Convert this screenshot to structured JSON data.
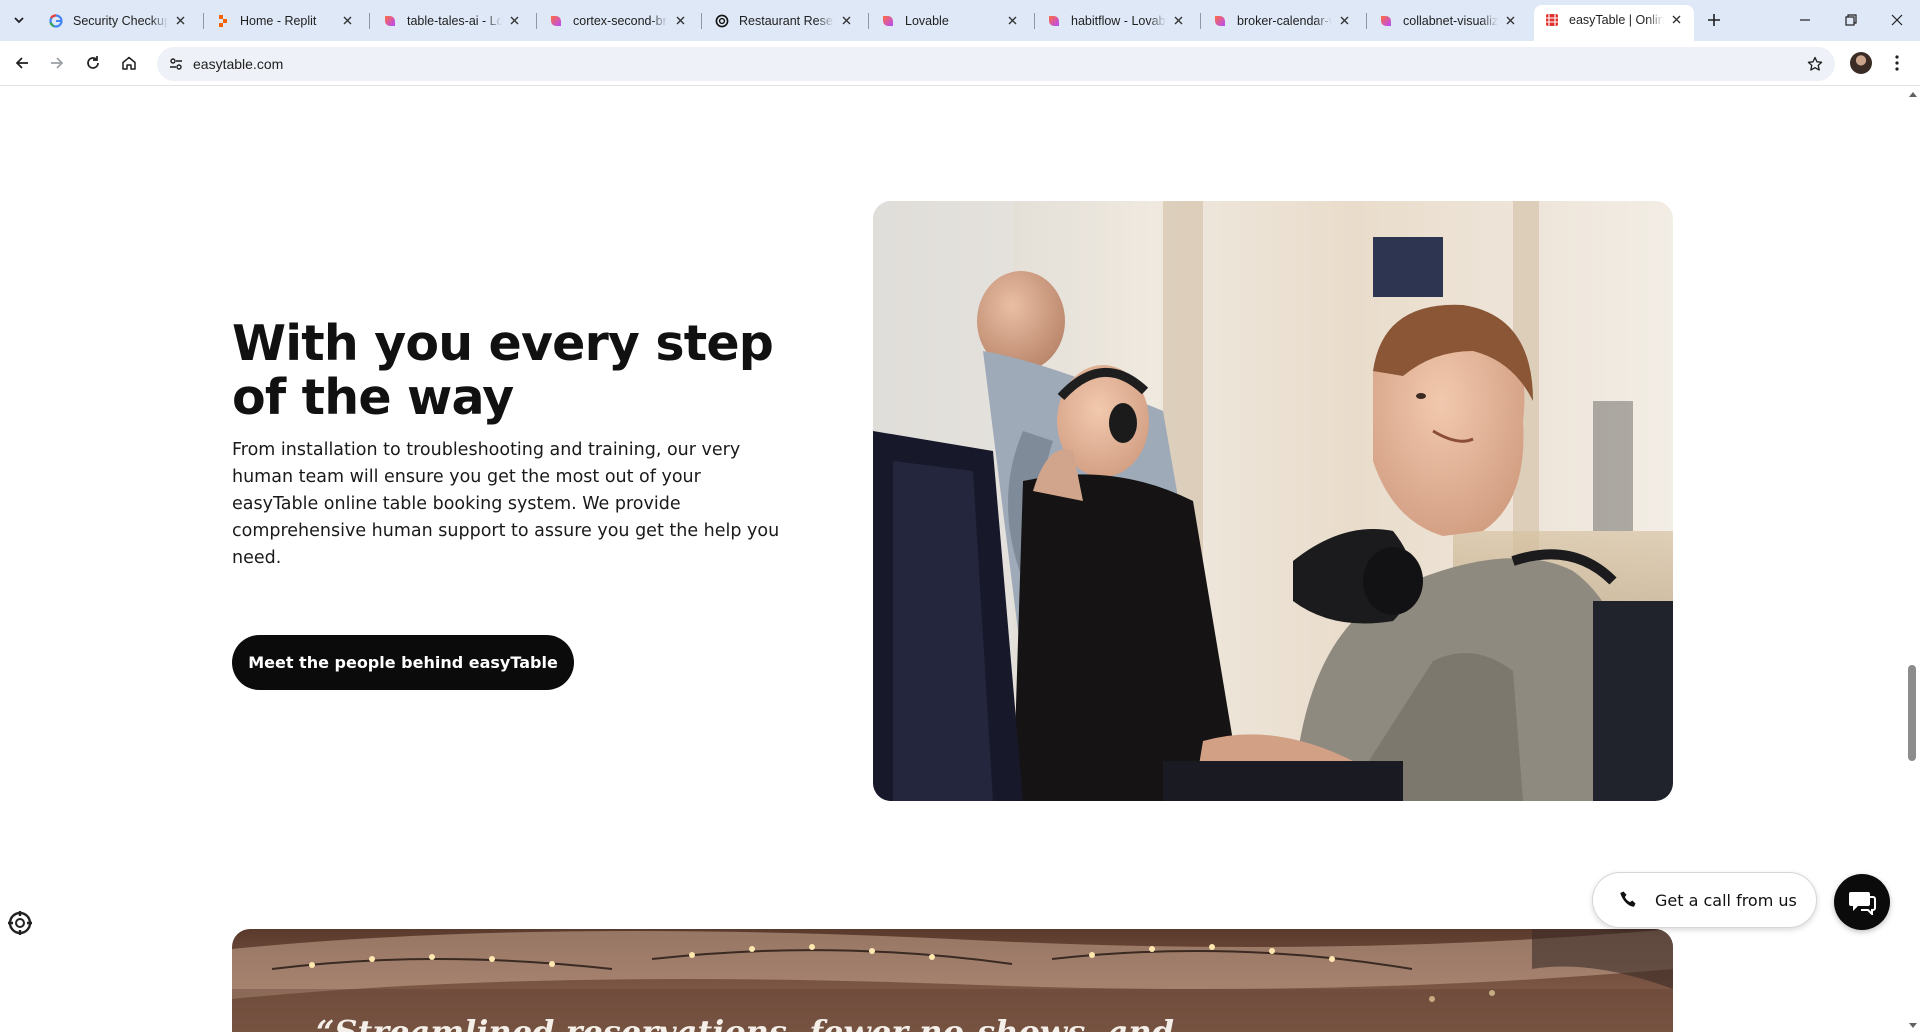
{
  "browser": {
    "tabs": [
      {
        "title": "Security Checkup",
        "icon": "google-icon"
      },
      {
        "title": "Home - Replit",
        "icon": "replit-icon"
      },
      {
        "title": "table-tales-ai - Lovable",
        "icon": "lovable-icon"
      },
      {
        "title": "cortex-second-brain - Lovable",
        "icon": "lovable-icon"
      },
      {
        "title": "Restaurant Reservation",
        "icon": "openai-icon"
      },
      {
        "title": "Lovable",
        "icon": "lovable-icon"
      },
      {
        "title": "habitflow - Lovable",
        "icon": "lovable-icon"
      },
      {
        "title": "broker-calendar-view - Lovable",
        "icon": "lovable-icon"
      },
      {
        "title": "collabnet-visualizer - Lovable",
        "icon": "lovable-icon"
      },
      {
        "title": "easyTable | Online table booking",
        "icon": "easytable-icon",
        "active": true
      }
    ],
    "url": "easytable.com"
  },
  "section": {
    "heading": "With you every step of the way",
    "body": "From installation to troubleshooting and training, our very human team will ensure you get the most out of your easyTable online table booking system. We provide comprehensive human support to assure you get the help you need.",
    "cta_label": "Meet the people behind easyTable",
    "photo_alt": "support team at computers with headsets"
  },
  "banner": {
    "quote": "“Streamlined reservations, fewer no-shows, and"
  },
  "floating": {
    "call_label": "Get a call from us"
  },
  "colors": {
    "tabstrip": "#dfe8f7",
    "cta_bg": "#0b0b0b",
    "text": "#111111"
  }
}
